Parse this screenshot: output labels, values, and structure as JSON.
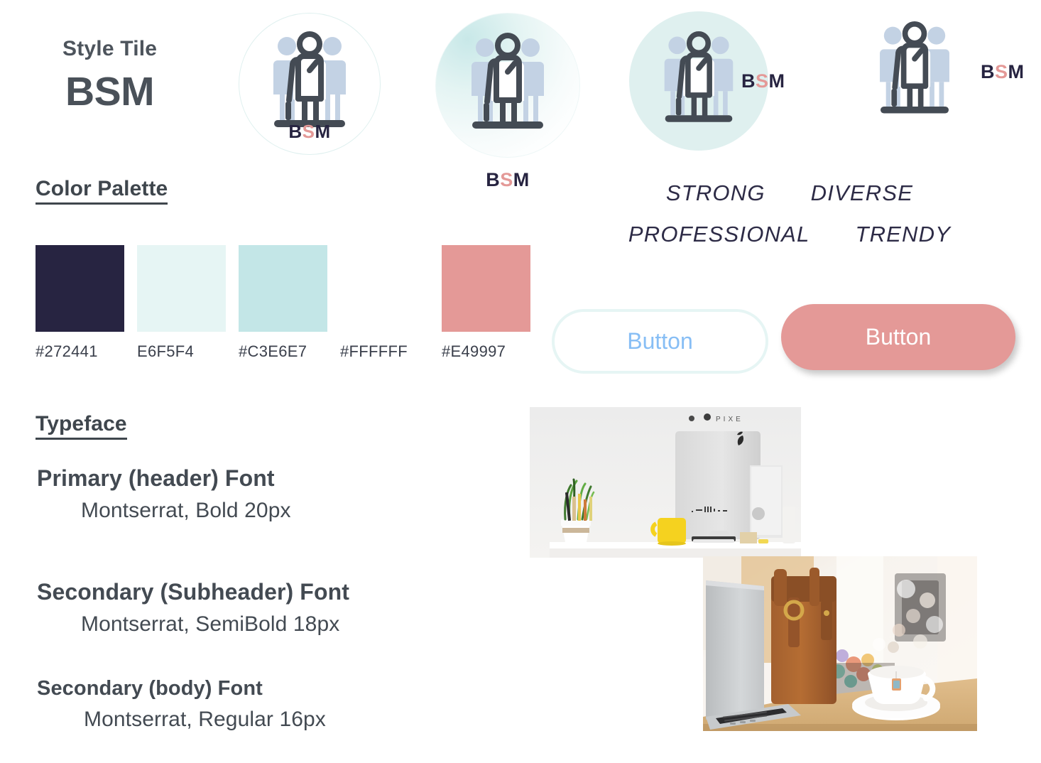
{
  "header": {
    "label": "Style Tile",
    "brand": "BSM"
  },
  "logo": {
    "letters": {
      "first": "B",
      "second": "S",
      "third": "M"
    },
    "colors": {
      "dark": "#272441",
      "accent": "#E49997",
      "back_figure": "#c3d2e4",
      "circle_solid": "#dff0ef"
    },
    "variants": [
      {
        "name": "outline-circle-stacked",
        "circle_style": "outline",
        "text_position": "bottom-overlap"
      },
      {
        "name": "gradient-circle-stacked",
        "circle_style": "gradient",
        "text_position": "below"
      },
      {
        "name": "solid-circle-horizontal",
        "circle_style": "solid",
        "text_position": "right-inside"
      },
      {
        "name": "no-circle-horizontal",
        "circle_style": "none",
        "text_position": "right"
      }
    ]
  },
  "palette": {
    "heading": "Color Palette",
    "swatches": [
      {
        "code": "#272441",
        "hex": "#272441"
      },
      {
        "code": "E6F5F4",
        "hex": "#E6F5F4"
      },
      {
        "code": "#C3E6E7",
        "hex": "#C3E6E7"
      },
      {
        "code": "#FFFFFF",
        "hex": "#FFFFFF"
      },
      {
        "code": "#E49997",
        "hex": "#E49997"
      }
    ]
  },
  "adjectives": {
    "row1": [
      "STRONG",
      "DIVERSE"
    ],
    "row2": [
      "PROFESSIONAL",
      "TRENDY"
    ]
  },
  "buttons": {
    "outline": {
      "label": "Button",
      "text_color": "#87BEF5",
      "border_color": "#E6F5F4",
      "background": "#FFFFFF"
    },
    "filled": {
      "label": "Button",
      "text_color": "#FFFFFF",
      "background": "#E49997"
    }
  },
  "typeface": {
    "heading": "Typeface",
    "entries": [
      {
        "name": "Primary (header) Font",
        "spec": "Montserrat, Bold 20px"
      },
      {
        "name": "Secondary (Subheader) Font",
        "spec": "Montserrat, SemiBold 18px"
      },
      {
        "name": "Secondary (body) Font",
        "spec": "Montserrat, Regular 16px"
      }
    ]
  },
  "photos": [
    {
      "name": "desk-with-imac-plant-and-yellow-mug",
      "alt": "White desk with potted plant of pencils, yellow mug and iMac against a white wall"
    },
    {
      "name": "laptop-with-leather-bag-and-teacup",
      "alt": "Laptop on wooden table with brown leather bag and white teacup, bokeh lights behind"
    }
  ]
}
